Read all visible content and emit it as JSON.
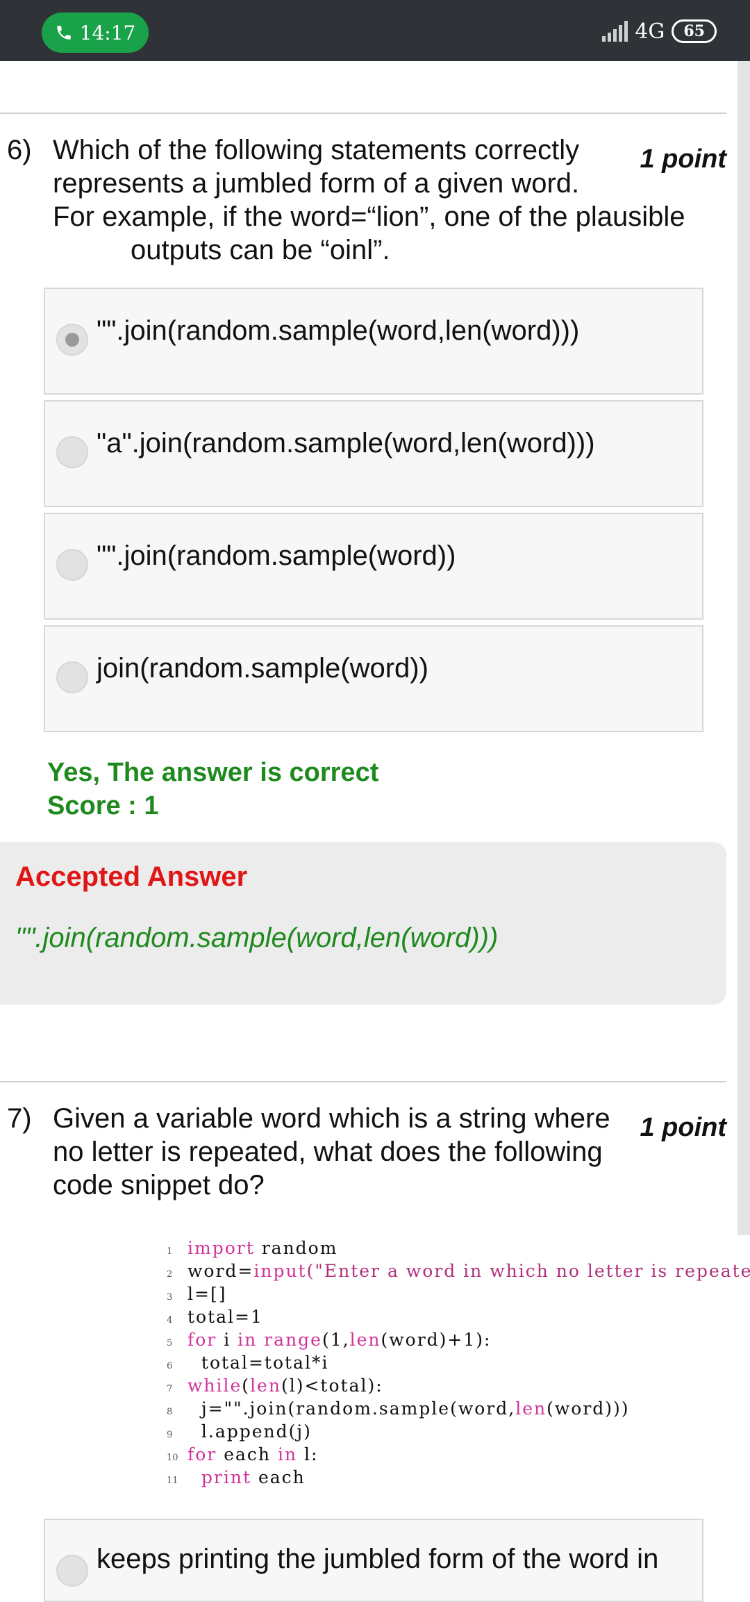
{
  "status_bar": {
    "time": "14:17",
    "network": "4G",
    "battery": "65"
  },
  "question6": {
    "number": "6)",
    "text_lines": [
      "Which of the following statements correctly",
      "represents a jumbled form of a given word.",
      "For example, if the word=“lion”, one of the plausible",
      "outputs can be “oinl”."
    ],
    "points": "1 point",
    "options": [
      {
        "label": "\"\".join(random.sample(word,len(word)))",
        "selected": true
      },
      {
        "label": "\"a\".join(random.sample(word,len(word)))",
        "selected": false
      },
      {
        "label": "\"\".join(random.sample(word))",
        "selected": false
      },
      {
        "label": "join(random.sample(word))",
        "selected": false
      }
    ],
    "feedback": "Yes, The answer is correct",
    "score": "Score : 1",
    "accepted_title": "Accepted Answer",
    "accepted_answer": "\"\".join(random.sample(word,len(word)))"
  },
  "question7": {
    "number": "7)",
    "text_lines": [
      "Given a variable word which is a string where",
      "no letter is repeated, what does the following",
      "code snippet do?"
    ],
    "points": "1 point",
    "code_lines": [
      {
        "n": "1",
        "indent": "",
        "kw": "import",
        "rest": " random"
      },
      {
        "n": "2",
        "indent": "",
        "pre": "word=",
        "kw": "input",
        "rest": "(\"Enter a word in which no letter is repeated\")"
      },
      {
        "n": "3",
        "indent": "",
        "rest": "l=[]"
      },
      {
        "n": "4",
        "indent": "",
        "rest": "total=1"
      },
      {
        "n": "5",
        "indent": "",
        "kw": "for",
        "rest": " i ",
        "kw2": "in",
        "kw3": " range",
        "rest2": "(1,",
        "kw4": "len",
        "rest3": "(word)+1):"
      },
      {
        "n": "6",
        "indent": "  ",
        "rest": "total=total*i"
      },
      {
        "n": "7",
        "indent": "",
        "kw": "while",
        "rest": "(",
        "kw2": "len",
        "rest2": "(l)<total):"
      },
      {
        "n": "8",
        "indent": "  ",
        "rest": "j=\"\".join(random.sample(word,",
        "kw2": "len",
        "rest2": "(word)))"
      },
      {
        "n": "9",
        "indent": "  ",
        "rest": "l.append(j)"
      },
      {
        "n": "10",
        "indent": "",
        "kw": "for",
        "rest": " each ",
        "kw2": "in",
        "rest2": " l:"
      },
      {
        "n": "11",
        "indent": "  ",
        "kw": "print",
        "rest": " each"
      }
    ],
    "first_option": "keeps printing the jumbled form of the word in"
  }
}
